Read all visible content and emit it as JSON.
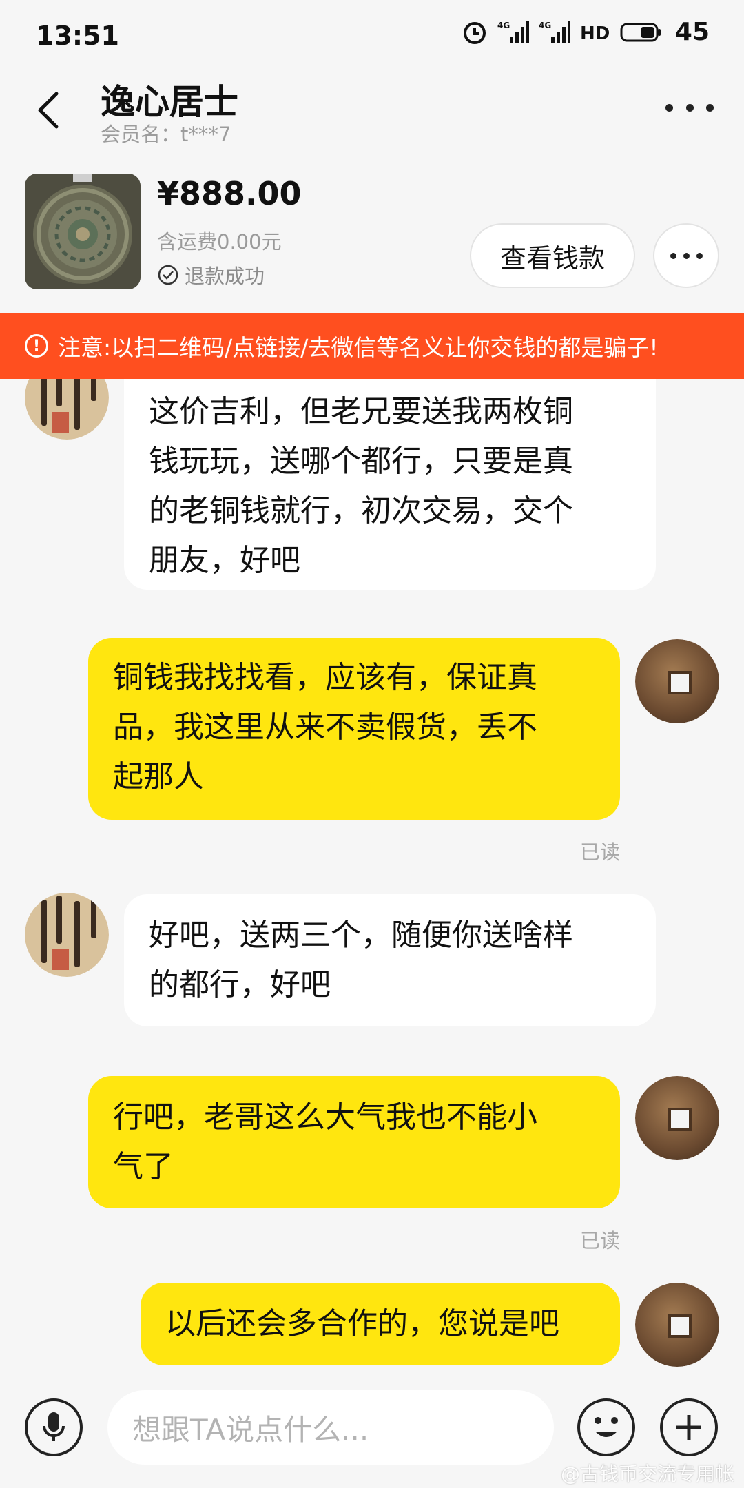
{
  "status_bar": {
    "time": "13:51",
    "battery": "45"
  },
  "header": {
    "title": "逸心居士",
    "subtitle": "会员名：t***7"
  },
  "product": {
    "price": "¥888.00",
    "shipping": "含运费0.00元",
    "status": "退款成功",
    "view_button": "查看钱款"
  },
  "warning": {
    "text": "注意:以扫二维码/点链接/去微信等名义让你交钱的都是骗子!"
  },
  "messages": [
    {
      "side": "in",
      "lines": [
        "这价吉利，但老兄要送我两枚铜",
        "钱玩玩，送哪个都行，只要是真",
        "的老铜钱就行，初次交易，交个",
        "朋友，好吧"
      ]
    },
    {
      "side": "out",
      "lines": [
        "铜钱我找找看，应该有，保证真",
        "品，我这里从来不卖假货，丢不",
        "起那人"
      ],
      "read": "已读"
    },
    {
      "side": "in",
      "lines": [
        "好吧，送两三个，随便你送啥样",
        "的都行，好吧"
      ]
    },
    {
      "side": "out",
      "lines": [
        "行吧，老哥这么大气我也不能小",
        "气了"
      ],
      "read": "已读"
    },
    {
      "side": "out",
      "lines": [
        "以后还会多合作的，您说是吧"
      ]
    }
  ],
  "input": {
    "placeholder": "想跟TA说点什么..."
  },
  "watermark": "@古钱币交流专用帐"
}
